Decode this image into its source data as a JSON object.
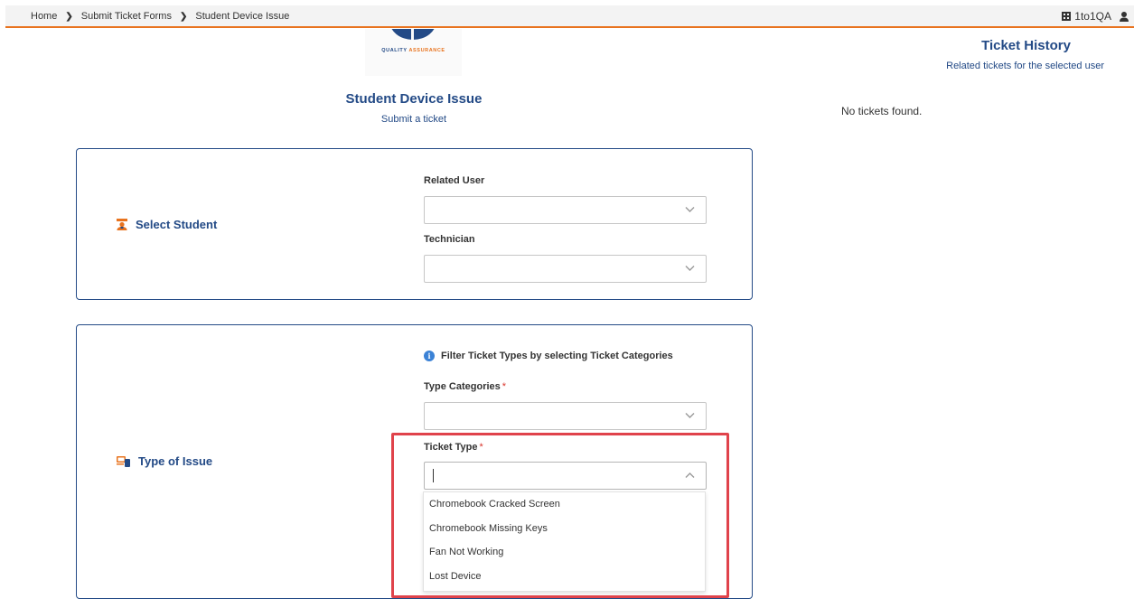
{
  "breadcrumb": {
    "items": [
      "Home",
      "Submit Ticket Forms",
      "Student Device Issue"
    ]
  },
  "topbar": {
    "org_name": "1to1QA",
    "org_icon": "building-icon",
    "user_icon": "user-icon",
    "accent_color": "#e8731e"
  },
  "logo": {
    "text_part1": "QUALITY",
    "text_part2": "ASSURANCE"
  },
  "page": {
    "title": "Student Device Issue",
    "subtitle": "Submit a ticket",
    "title_color": "#234a86"
  },
  "history": {
    "title": "Ticket History",
    "subtitle": "Related tickets for the selected user",
    "empty_text": "No tickets found."
  },
  "select_student": {
    "label": "Select Student",
    "icon": "student-icon",
    "related_user": {
      "label": "Related User",
      "value": ""
    },
    "technician": {
      "label": "Technician",
      "value": ""
    }
  },
  "type_of_issue": {
    "label": "Type of Issue",
    "icon": "devices-icon",
    "info_text": "Filter Ticket Types by selecting Ticket Categories",
    "type_categories": {
      "label": "Type Categories",
      "required_mark": "*",
      "value": ""
    },
    "ticket_type": {
      "label": "Ticket Type",
      "required_mark": "*",
      "value": "",
      "expanded": true,
      "options": [
        "Chromebook Cracked Screen",
        "Chromebook Missing Keys",
        "Fan Not Working",
        "Lost Device"
      ]
    }
  },
  "highlight_color": "#e0434b"
}
